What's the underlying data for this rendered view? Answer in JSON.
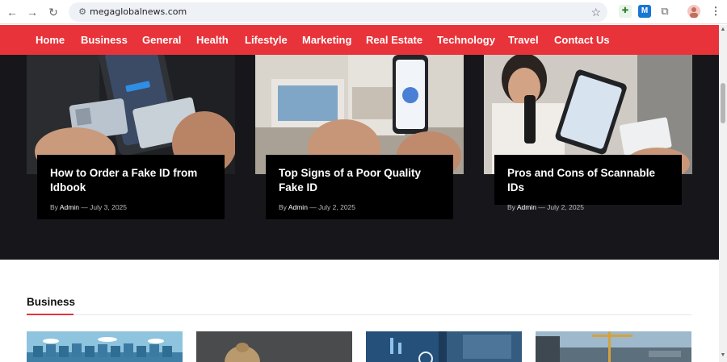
{
  "browser": {
    "url": "megaglobalnews.com",
    "back_icon": "←",
    "forward_icon": "→",
    "reload_icon": "↻",
    "star_icon": "☆"
  },
  "nav": {
    "items": [
      "Home",
      "Business",
      "General",
      "Health",
      "Lifestyle",
      "Marketing",
      "Real Estate",
      "Technology",
      "Travel",
      "Contact Us"
    ]
  },
  "featured": [
    {
      "title": "How to Order a Fake ID from Idbook",
      "by": "By",
      "author": "Admin",
      "sep": "—",
      "date": "July 3, 2025"
    },
    {
      "title": "Top Signs of a Poor Quality Fake ID",
      "by": "By",
      "author": "Admin",
      "sep": "—",
      "date": "July 2, 2025"
    },
    {
      "title": "Pros and Cons of Scannable IDs",
      "by": "By",
      "author": "Admin",
      "sep": "—",
      "date": "July 2, 2025"
    }
  ],
  "section": {
    "title": "Business"
  },
  "colors": {
    "accent": "#e8333a",
    "hero_bg": "#17171b"
  }
}
